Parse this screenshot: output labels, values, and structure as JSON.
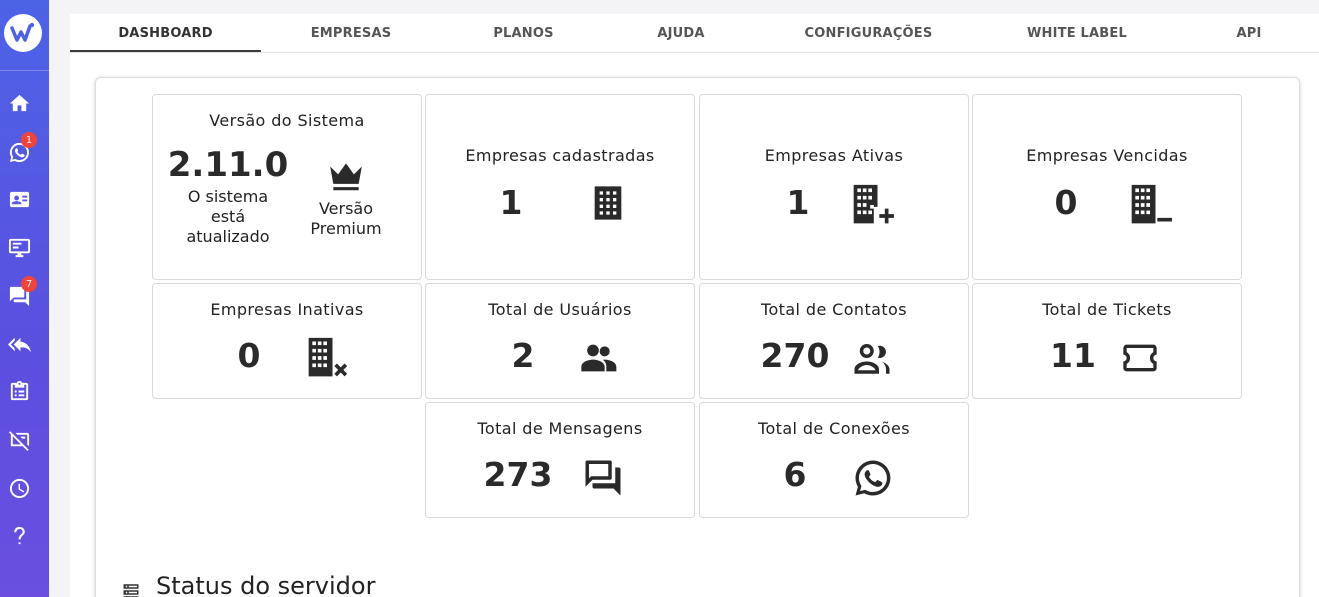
{
  "sidebar": {
    "badges": {
      "whatsapp": "1",
      "chats": "7"
    },
    "icons": [
      "home-icon",
      "whatsapp-icon",
      "contact-card-icon",
      "monitor-icon",
      "chat-icon",
      "reply-all-icon",
      "clipboard-icon",
      "speaker-off-icon",
      "clock-icon",
      "help-icon"
    ]
  },
  "tabs": [
    "DASHBOARD",
    "EMPRESAS",
    "PLANOS",
    "AJUDA",
    "CONFIGURAÇÕES",
    "WHITE LABEL",
    "API"
  ],
  "version_card": {
    "title": "Versão do Sistema",
    "version": "2.11.0",
    "status_line1": "O sistema",
    "status_line2": "está",
    "status_line3": "atualizado",
    "plan_line1": "Versão",
    "plan_line2": "Premium"
  },
  "stats": {
    "empresas_cadastradas": {
      "title": "Empresas cadastradas",
      "value": "1"
    },
    "empresas_ativas": {
      "title": "Empresas Ativas",
      "value": "1"
    },
    "empresas_vencidas": {
      "title": "Empresas Vencidas",
      "value": "0"
    },
    "empresas_inativas": {
      "title": "Empresas Inativas",
      "value": "0"
    },
    "total_usuarios": {
      "title": "Total de Usuários",
      "value": "2"
    },
    "total_contatos": {
      "title": "Total de Contatos",
      "value": "270"
    },
    "total_tickets": {
      "title": "Total de Tickets",
      "value": "11"
    },
    "total_mensagens": {
      "title": "Total de Mensagens",
      "value": "273"
    },
    "total_conexoes": {
      "title": "Total de Conexões",
      "value": "6"
    }
  },
  "status_section": {
    "title": "Status do servidor"
  },
  "colors": {
    "sidebar_top": "#4c63e6",
    "sidebar_bottom": "#6a4fe0",
    "badge": "#f44336"
  }
}
